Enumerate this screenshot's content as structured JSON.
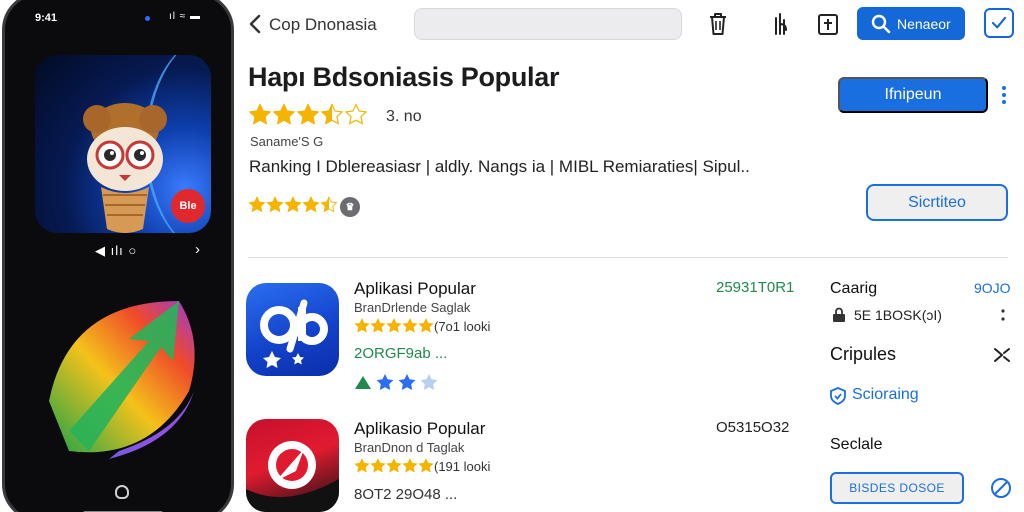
{
  "phone": {
    "time": "9:41",
    "signal": "ıl ≈ ▬",
    "badge": "Ble",
    "controls": "◀ ılı ○",
    "controls_next": "›"
  },
  "toolbar": {
    "title": "Cop Dnonasia",
    "search_placeholder": "",
    "primary_label": "Nenaeor"
  },
  "hero": {
    "title": "Hapı Bdsoniasis Popular",
    "rating": 3.5,
    "rating_text": "3. no",
    "subtitle": "Saname'S G",
    "ranking": "Ranking I Dblereasiasr | aldly. Nangs ia | MIBL Remiaraties| Sipul..",
    "rating2": 4.5,
    "badge": "♛",
    "get_label": "Ifnipeun",
    "secondary_label": "Sicrtiteo"
  },
  "list": [
    {
      "name": "Aplikasi Popular",
      "developer": "BranDrlende Saglak",
      "rating": 5,
      "reviews": "(7o1 looki",
      "price": "2ORGF9ab ...",
      "code": "25931T0R1",
      "code_color": "#1f8a4c",
      "price_color": "#1f8a4c",
      "icon_text": "O/b"
    },
    {
      "name": "Aplikasio Popular",
      "developer": "BranDnon d  Taglak",
      "rating": 5,
      "reviews": "(191 looki",
      "price": "8OT2 29O48 ...",
      "code": "O5315O32",
      "code_color": "#222222",
      "price_color": "#333333"
    }
  ],
  "side": {
    "cat_label": "Caarig",
    "cat_code": "9OJO",
    "lock_text": "5E 1BOSK(ɔI)",
    "complies_label": "Cripules",
    "scoring_label": "Scioraing",
    "section_label": "Seclale",
    "outline_label": "BISDES DOSOE"
  },
  "colors": {
    "accent": "#1a6fe0",
    "star": "#f5b400",
    "green": "#1f8a4c"
  }
}
